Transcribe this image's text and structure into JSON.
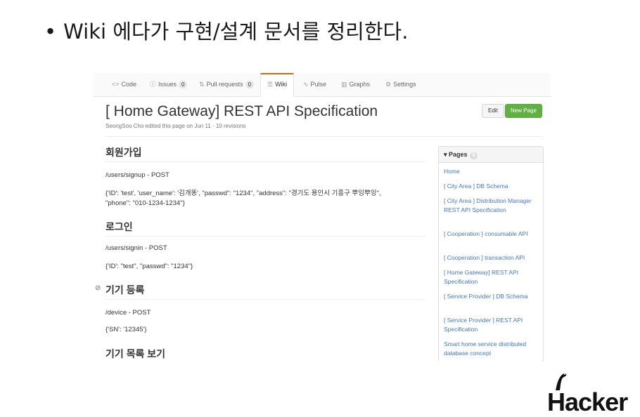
{
  "slide": {
    "bullet": "•",
    "title": "Wiki 에다가 구현/설계 문서를 정리한다."
  },
  "tabs": [
    {
      "icon": "<>",
      "label": "Code"
    },
    {
      "icon": "ⓘ",
      "label": "Issues",
      "count": "0"
    },
    {
      "icon": "⇅",
      "label": "Pull requests",
      "count": "0"
    },
    {
      "icon": "☰",
      "label": "Wiki"
    },
    {
      "icon": "∿",
      "label": "Pulse"
    },
    {
      "icon": "▥",
      "label": "Graphs"
    },
    {
      "icon": "⚙",
      "label": "Settings"
    }
  ],
  "page": {
    "title": "[ Home Gateway] REST API Specification",
    "meta": "SeongSoo Cho edited this page on Jun 11 · 10 revisions",
    "edit_label": "Edit",
    "new_page_label": "New Page"
  },
  "sections": {
    "signup": {
      "heading": "회원가입",
      "endpoint": "/users/signup - POST",
      "body_line1": "{'ID': 'test', 'user_name': '김개똥', \"passwd\": \"1234\", \"address\": \"경기도 용인시 기흥구 뿌잉뿌잉\",",
      "body_line2": "\"phone\": \"010-1234-1234\"}"
    },
    "signin": {
      "heading": "로그인",
      "endpoint": "/users/signin - POST",
      "body": "{'ID': \"test\", \"passwd\": \"1234\"}"
    },
    "device_register": {
      "heading": "기기 등록",
      "endpoint": "/device - POST",
      "body": "{'SN': '12345'}"
    },
    "device_list": {
      "heading": "기기 목록 보기"
    }
  },
  "sidebar": {
    "title": "Pages",
    "count": "0",
    "items": [
      "Home",
      "[ City Area ] DB Schema",
      "[ City Area ] Distribution Manager REST API Specification",
      "[ Cooperation ] consumable API",
      "[ Cooperation ] transaction API",
      "[ Home Gateway] REST API Specification",
      "[ Service Provider ] DB Schema",
      "[ Service Provider ] REST API Specification",
      "Smart home service distributed database concept"
    ]
  },
  "logo": {
    "text": "Hacker"
  },
  "colors": {
    "link": "#4078c0",
    "new_page_button": "#60b044",
    "active_tab_border": "#d26911"
  }
}
